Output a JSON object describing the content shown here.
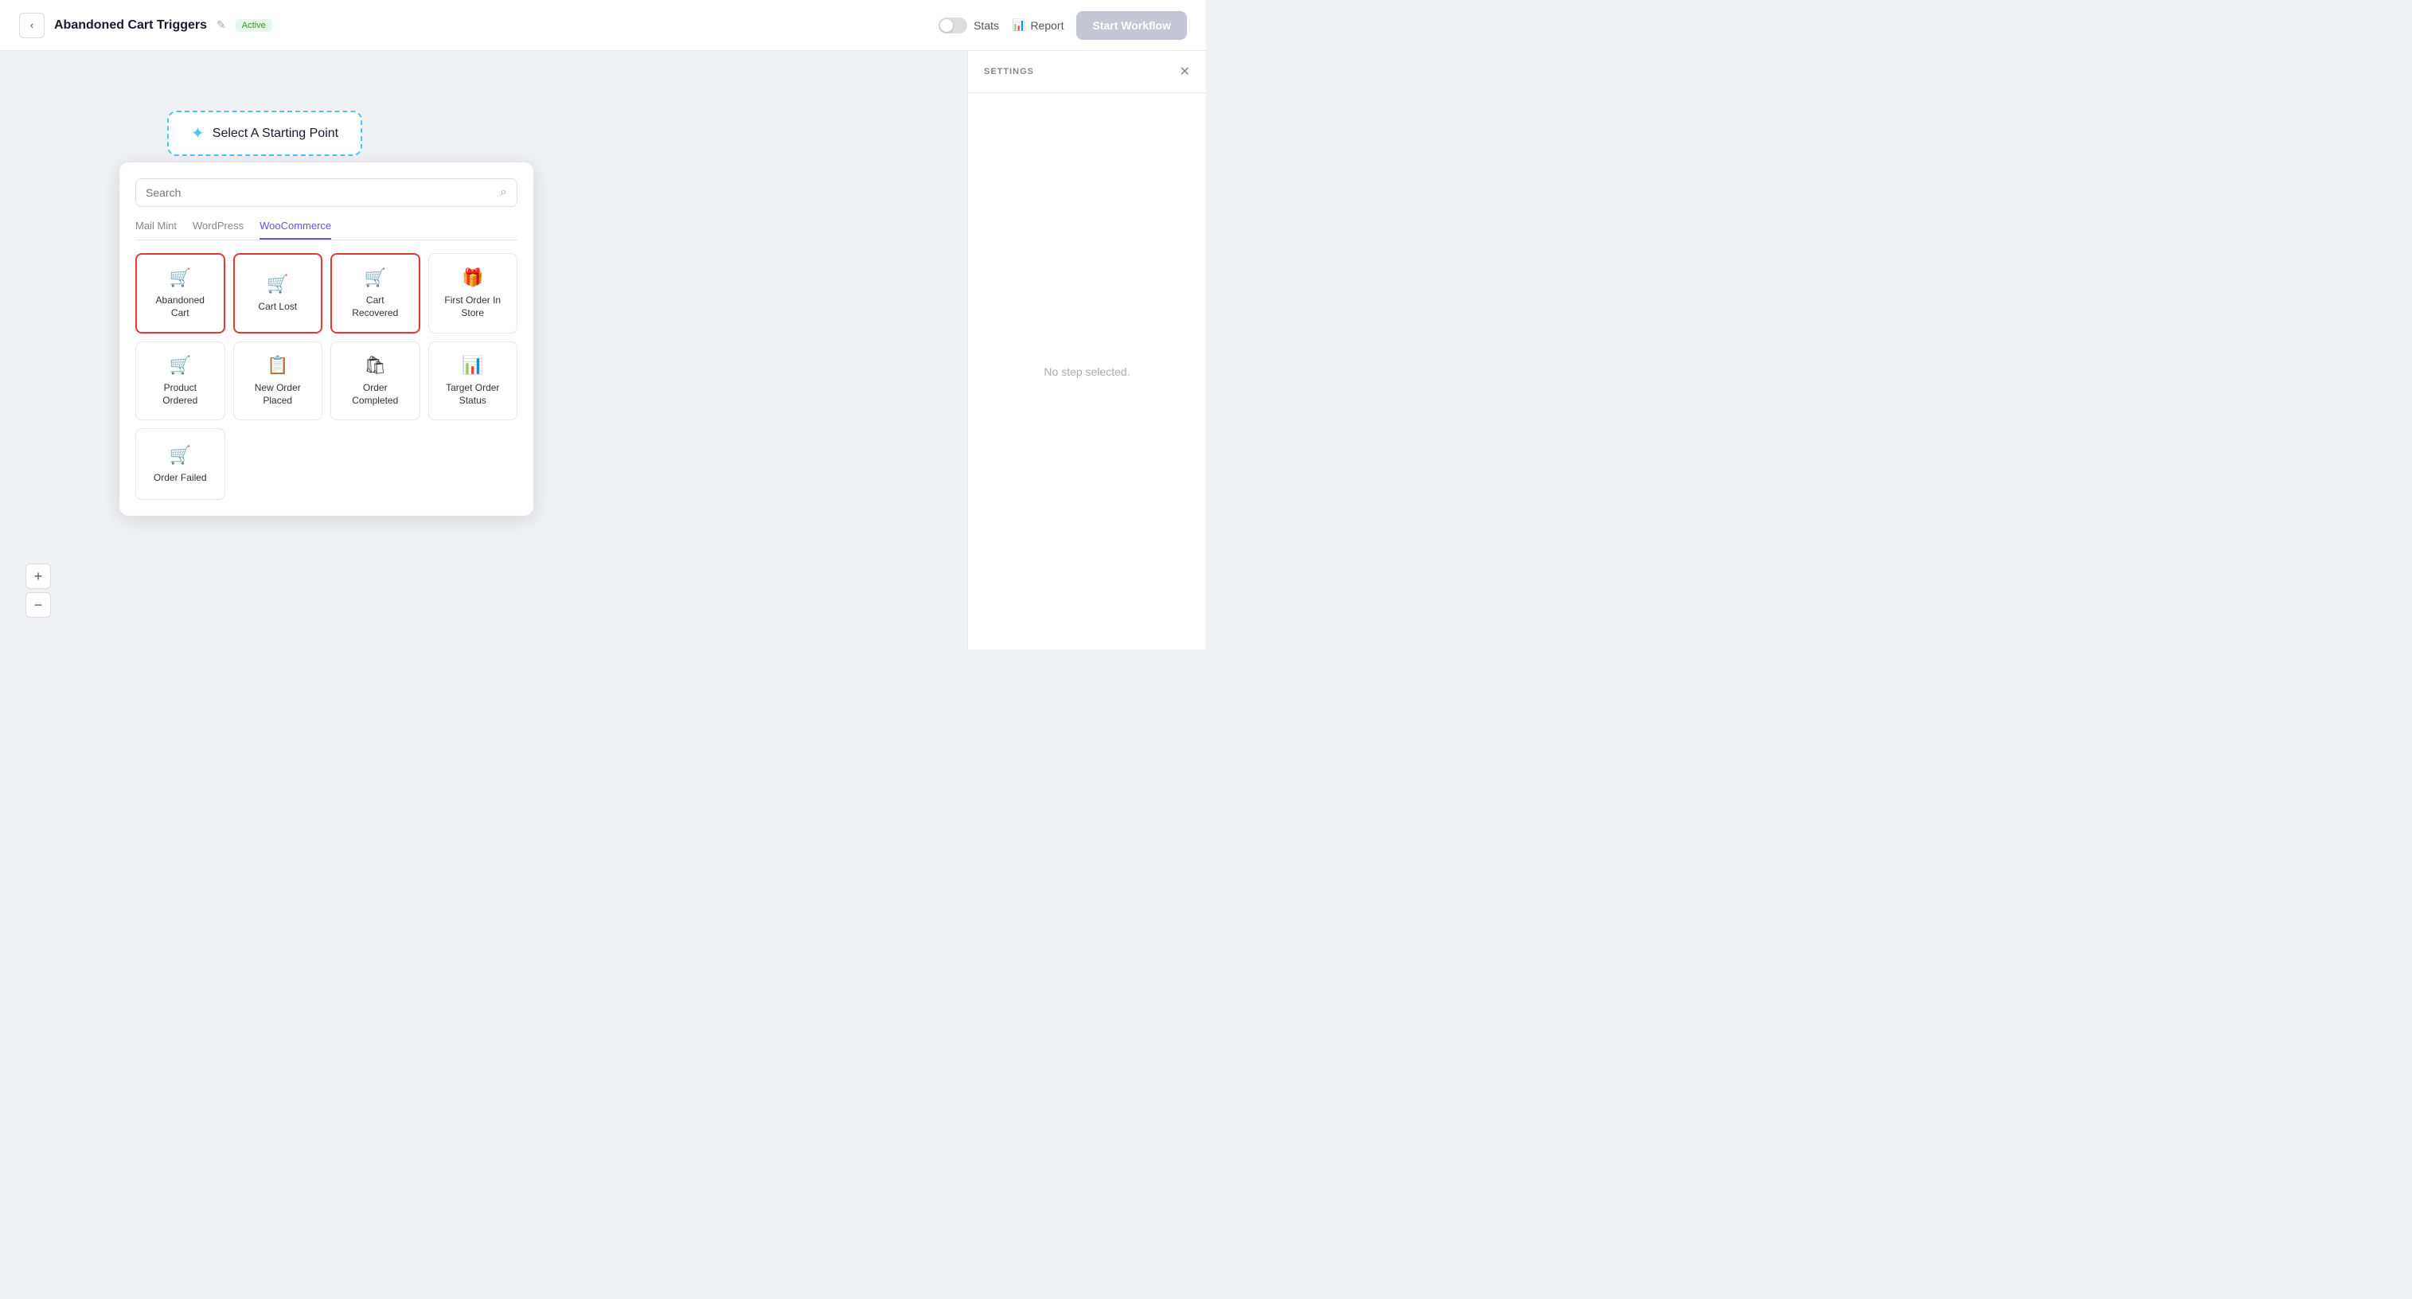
{
  "header": {
    "back_label": "‹",
    "title": "Abandoned Cart Triggers",
    "edit_icon": "✎",
    "active_badge": "Active",
    "stats_label": "Stats",
    "report_label": "Report",
    "start_workflow_label": "Start Workflow"
  },
  "settings": {
    "title": "SETTINGS",
    "no_step_text": "No step selected.",
    "close_icon": "✕"
  },
  "canvas": {
    "starting_point_text": "Select A Starting Point"
  },
  "search": {
    "placeholder": "Search"
  },
  "tabs": [
    {
      "id": "mail-mint",
      "label": "Mail Mint",
      "active": false
    },
    {
      "id": "wordpress",
      "label": "WordPress",
      "active": false
    },
    {
      "id": "woocommerce",
      "label": "WooCommerce",
      "active": true
    }
  ],
  "triggers": [
    {
      "id": "abandoned-cart",
      "label": "Abandoned\nCart",
      "icon": "🛒",
      "selected": true
    },
    {
      "id": "cart-lost",
      "label": "Cart Lost",
      "icon": "🛒",
      "selected": true
    },
    {
      "id": "cart-recovered",
      "label": "Cart\nRecovered",
      "icon": "🛒",
      "selected": true
    },
    {
      "id": "first-order-in-store",
      "label": "First Order In\nStore",
      "icon": "🎁",
      "selected": false
    },
    {
      "id": "product-ordered",
      "label": "Product\nOrdered",
      "icon": "🛒",
      "selected": false
    },
    {
      "id": "new-order-placed",
      "label": "New Order\nPlaced",
      "icon": "📋",
      "selected": false
    },
    {
      "id": "order-completed",
      "label": "Order\nCompleted",
      "icon": "🛍",
      "selected": false
    },
    {
      "id": "target-order-status",
      "label": "Target Order\nStatus",
      "icon": "📊",
      "selected": false
    },
    {
      "id": "order-failed",
      "label": "Order Failed",
      "icon": "🛒",
      "selected": false
    }
  ],
  "zoom": {
    "plus": "+",
    "minus": "−"
  }
}
